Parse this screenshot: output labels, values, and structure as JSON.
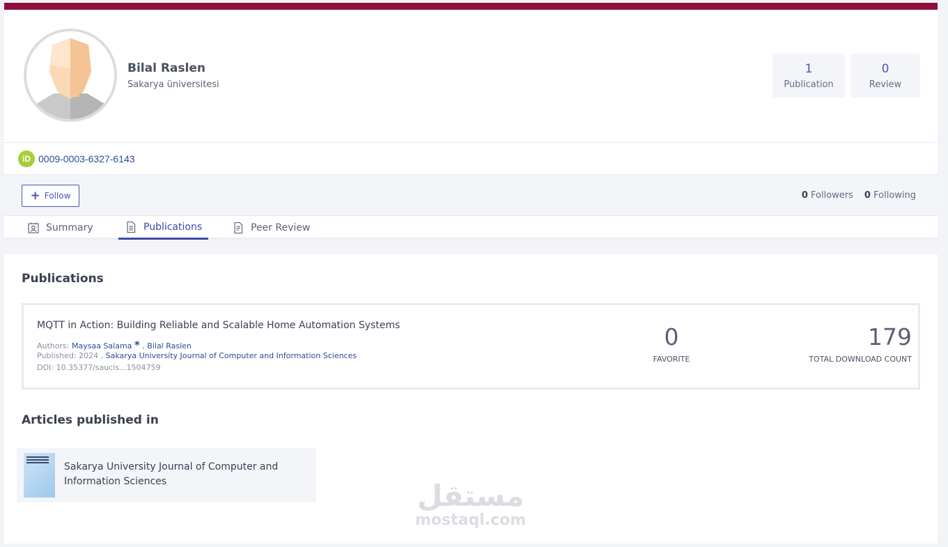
{
  "profile": {
    "name": "Bilal Raslen",
    "affiliation": "Sakarya üniversitesi",
    "orcid_badge": "iD",
    "orcid": "0009-0003-6327-6143",
    "stats": [
      {
        "value": "1",
        "label": "Publication"
      },
      {
        "value": "0",
        "label": "Review"
      }
    ]
  },
  "follow": {
    "button_label": "Follow",
    "followers_count": "0",
    "followers_label": "Followers",
    "following_count": "0",
    "following_label": "Following"
  },
  "tabs": [
    {
      "label": "Summary",
      "icon": "user-card-icon",
      "active": false
    },
    {
      "label": "Publications",
      "icon": "document-icon",
      "active": true
    },
    {
      "label": "Peer Review",
      "icon": "document-lines-icon",
      "active": false
    }
  ],
  "publications": {
    "heading": "Publications",
    "items": [
      {
        "title": "MQTT in Action: Building Reliable and Scalable Home Automation Systems",
        "authors_prefix": "Authors:",
        "author_1": "Maysaa Salama",
        "corresponding_mark": "*",
        "separator": ",",
        "author_2": "Bilal Raslen",
        "published_prefix": "Published: 2024 ,",
        "journal": "Sakarya University Journal of Computer and Information Sciences",
        "doi": "DOI: 10.35377/saucis...1504759",
        "favorite_value": "0",
        "favorite_label": "FAVORITE",
        "downloads_value": "179",
        "downloads_label": "TOTAL DOWNLOAD COUNT"
      }
    ]
  },
  "articles_published_in": {
    "heading": "Articles published in",
    "journals": [
      {
        "name": "Sakarya University Journal of Computer and Information Sciences"
      }
    ]
  },
  "watermark": {
    "arabic": "مستقل",
    "latin": "mostaql.com"
  },
  "colors": {
    "brand_bar": "#8f0f3c",
    "accent": "#3a4aa8",
    "orcid_green": "#a6ce39",
    "link": "#2a4a9a"
  }
}
